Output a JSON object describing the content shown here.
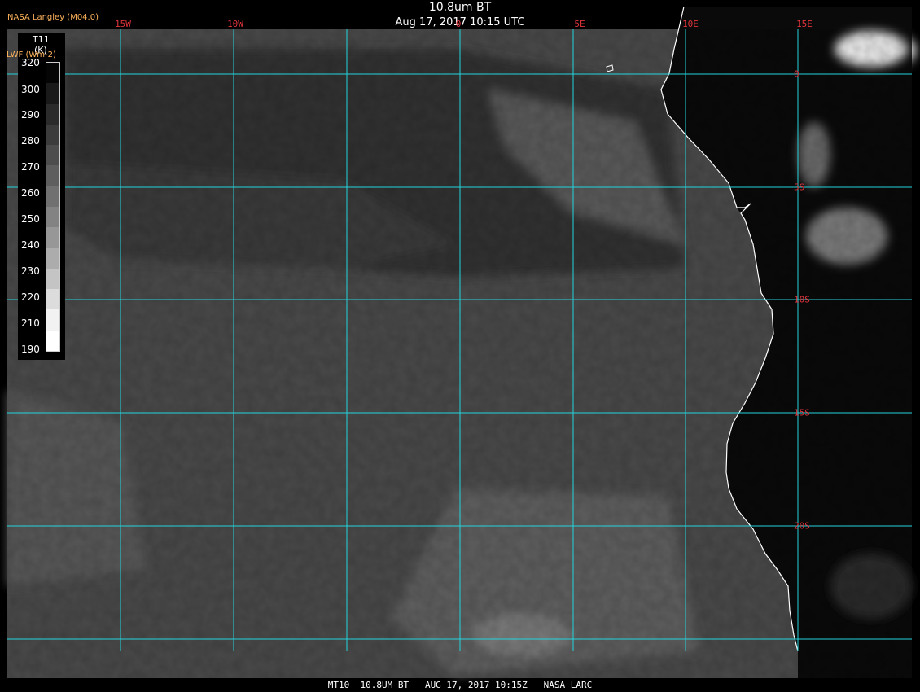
{
  "header": {
    "title": "10.8um BT",
    "subtitle": "Aug 17, 2017 10:15 UTC",
    "credit": "NASA Langley (M04.0)"
  },
  "legend": {
    "parameter": "T11",
    "unit": "(K)",
    "secondary_label": "LWF (Wm-2)",
    "ticks": [
      "320",
      "300",
      "290",
      "280",
      "270",
      "260",
      "250",
      "240",
      "230",
      "220",
      "210",
      "190"
    ],
    "colors": [
      "#050505",
      "#1a1a1a",
      "#2b2b2b",
      "#3c3c3c",
      "#4d4d4d",
      "#5e5e5e",
      "#707070",
      "#838383",
      "#979797",
      "#acacac",
      "#c4c4c4",
      "#dcdcdc",
      "#f2f2f2",
      "#ffffff"
    ]
  },
  "map": {
    "longitude_labels": [
      "15W",
      "10W",
      "0",
      "5E",
      "10E",
      "15E"
    ],
    "latitude_labels": [
      "0",
      "5S",
      "10S",
      "15S",
      "20S"
    ],
    "grid_color": "#22d4dc",
    "coastline_color": "#ffffff",
    "ocean_color": "#4a4a4a",
    "land_color": "#0a0a0a"
  },
  "footer": {
    "text": "MT10  10.8UM BT   AUG 17, 2017 10:15Z   NASA LARC"
  }
}
